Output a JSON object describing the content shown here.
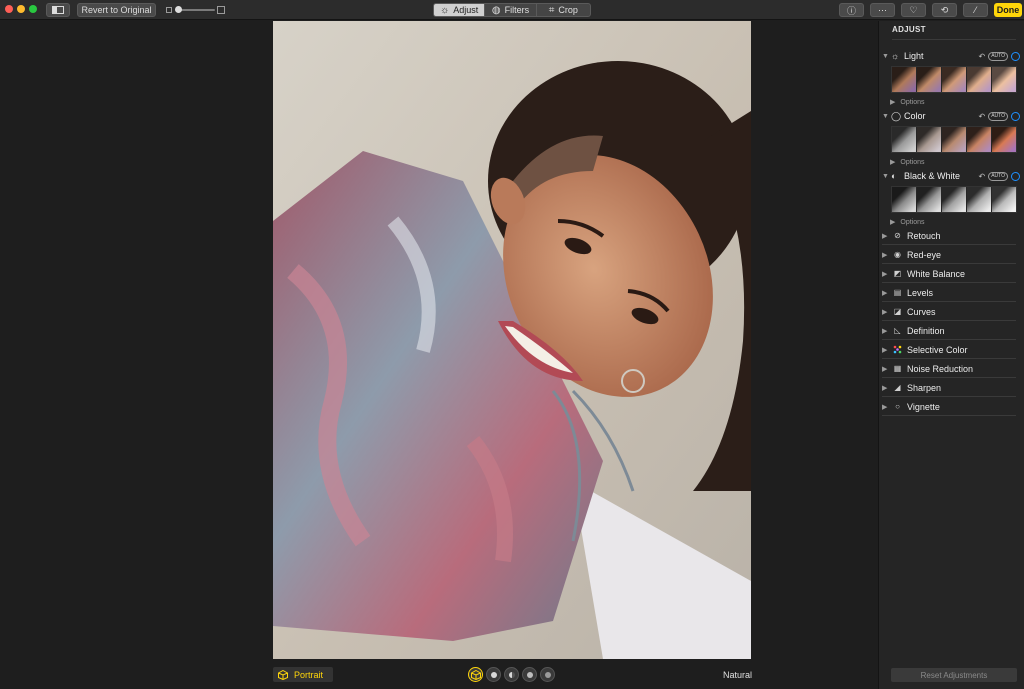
{
  "toolbar": {
    "revert_label": "Revert to Original",
    "tabs": [
      {
        "label": "Adjust",
        "icon": "sun-icon",
        "active": true
      },
      {
        "label": "Filters",
        "icon": "filters-icon",
        "active": false
      },
      {
        "label": "Crop",
        "icon": "crop-icon",
        "active": false
      }
    ],
    "done_label": "Done",
    "right_icons": [
      "info-icon",
      "more-icon",
      "heart-icon",
      "rotate-icon",
      "magic-wand-icon"
    ]
  },
  "canvas": {
    "mode_label": "Portrait",
    "lighting_label": "Natural"
  },
  "panel": {
    "title": "ADJUST",
    "sections": [
      {
        "label": "Light",
        "icon": "sun-icon",
        "auto": "AUTO",
        "options_label": "Options",
        "strip_style": "color"
      },
      {
        "label": "Color",
        "icon": "color-circle-icon",
        "auto": "AUTO",
        "options_label": "Options",
        "strip_style": "bw-soft"
      },
      {
        "label": "Black & White",
        "icon": "bw-circle-icon",
        "auto": "AUTO",
        "options_label": "Options",
        "strip_style": "bw"
      }
    ],
    "tools": [
      {
        "label": "Retouch",
        "icon": "bandage-icon"
      },
      {
        "label": "Red-eye",
        "icon": "eye-icon"
      },
      {
        "label": "White Balance",
        "icon": "white-balance-icon"
      },
      {
        "label": "Levels",
        "icon": "levels-icon"
      },
      {
        "label": "Curves",
        "icon": "curves-icon"
      },
      {
        "label": "Definition",
        "icon": "definition-icon"
      },
      {
        "label": "Selective Color",
        "icon": "selective-color-icon"
      },
      {
        "label": "Noise Reduction",
        "icon": "noise-icon"
      },
      {
        "label": "Sharpen",
        "icon": "sharpen-icon"
      },
      {
        "label": "Vignette",
        "icon": "vignette-icon"
      }
    ],
    "reset_label": "Reset Adjustments"
  },
  "colors": {
    "accent_yellow": "#ffd60a",
    "accent_blue": "#1e90ff"
  }
}
